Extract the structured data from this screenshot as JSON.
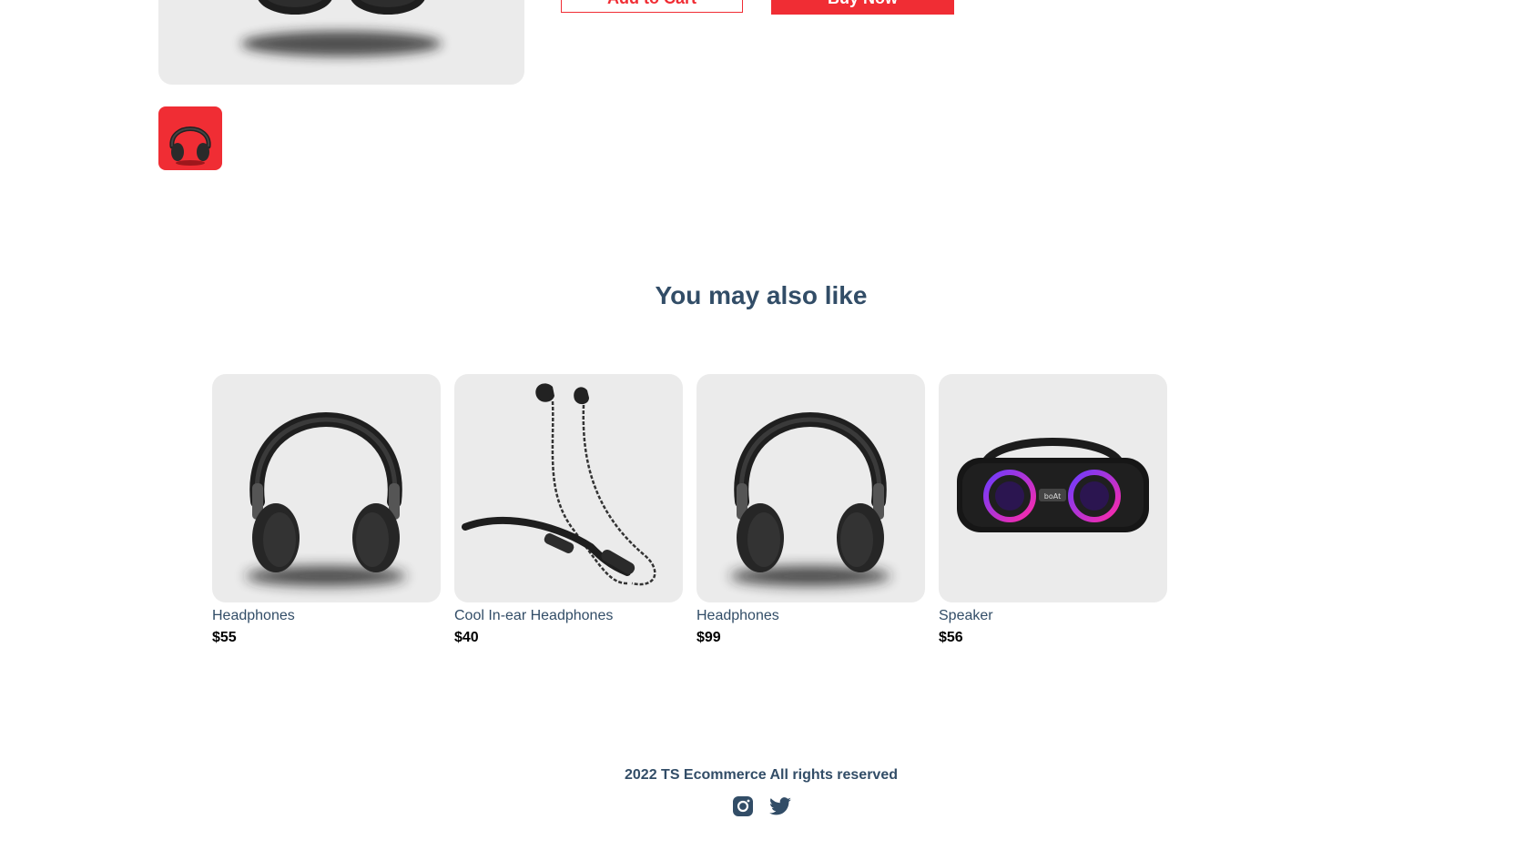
{
  "product_detail": {
    "add_to_cart_label": "Add to Cart",
    "buy_now_label": "Buy Now",
    "main_image_icon": "headphones-image",
    "thumbnail_icon": "headphones-thumbnail"
  },
  "related": {
    "heading": "You may also like",
    "items": [
      {
        "name": "Headphones",
        "price": "$55",
        "icon": "headphones-image"
      },
      {
        "name": "Cool In-ear Headphones",
        "price": "$40",
        "icon": "earphones-image"
      },
      {
        "name": "Headphones",
        "price": "$99",
        "icon": "headphones-image"
      },
      {
        "name": "Speaker",
        "price": "$56",
        "icon": "speaker-image"
      }
    ]
  },
  "footer": {
    "text": "2022 TS Ecommerce All rights reserved",
    "icons": [
      "instagram-icon",
      "twitter-icon"
    ]
  },
  "colors": {
    "accent": "#f02d34",
    "text": "#324d67",
    "card_bg": "#ebebeb"
  }
}
